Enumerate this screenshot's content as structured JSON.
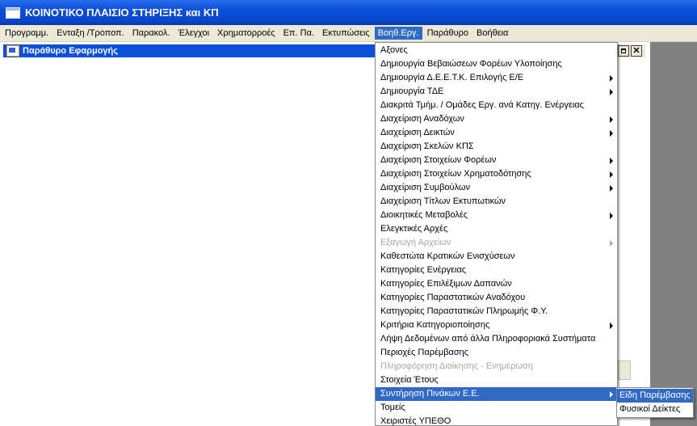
{
  "window": {
    "title": "ΚΟΙΝΟΤΙΚΟ ΠΛΑΙΣΙΟ ΣΤΗΡΙΞΗΣ και ΚΠ"
  },
  "menubar": {
    "items": [
      "Προγραμμ.",
      "Ενταξη /Τροποπ.",
      "Παρακολ.",
      "Έλεγχοι",
      "Χρηματορροές",
      "Επ. Πα.",
      "Εκτυπώσεις",
      "Βοηθ.Εργ.",
      "Παράθυρο",
      "Βοήθεια"
    ],
    "active_index": 7
  },
  "mdi_window": {
    "title": "Παράθυρο Εφαρμογής"
  },
  "menu": {
    "items": [
      {
        "label": "Αξονες",
        "submenu": false,
        "disabled": false
      },
      {
        "label": "Δημιουργία Βεβαιώσεων Φορέων Υλοποίησης",
        "submenu": false,
        "disabled": false
      },
      {
        "label": "Δημιουργία Δ.Ε.Ε.Τ.Κ. Επιλογής Ε/Ε",
        "submenu": true,
        "disabled": false
      },
      {
        "label": "Δημιουργία ΤΔΕ",
        "submenu": true,
        "disabled": false
      },
      {
        "label": "Διακριτά Τμήμ. / Ομάδες Εργ. ανά Κατηγ. Ενέργειας",
        "submenu": false,
        "disabled": false
      },
      {
        "label": "Διαχείριση Αναδόχων",
        "submenu": true,
        "disabled": false
      },
      {
        "label": "Διαχείριση Δεικτών",
        "submenu": true,
        "disabled": false
      },
      {
        "label": "Διαχείριση Σκελών ΚΠΣ",
        "submenu": false,
        "disabled": false
      },
      {
        "label": "Διαχείριση Στοιχείων Φορέων",
        "submenu": true,
        "disabled": false
      },
      {
        "label": "Διαχείριση Στοιχείων Χρηματοδότησης",
        "submenu": true,
        "disabled": false
      },
      {
        "label": "Διαχείριση Συμβούλων",
        "submenu": true,
        "disabled": false
      },
      {
        "label": "Διαχείριση Τίτλων Εκτυπωτικών",
        "submenu": false,
        "disabled": false
      },
      {
        "label": "Διοικητικές Μεταβολές",
        "submenu": true,
        "disabled": false
      },
      {
        "label": "Ελεγκτικές Αρχές",
        "submenu": false,
        "disabled": false
      },
      {
        "label": "Εξαγωγή Αρχείων",
        "submenu": true,
        "disabled": true
      },
      {
        "label": "Καθεστώτα Κρατικών Ενισχύσεων",
        "submenu": false,
        "disabled": false
      },
      {
        "label": "Κατηγορίες Ενέργειας",
        "submenu": false,
        "disabled": false
      },
      {
        "label": "Κατηγορίες Επιλέξιμων Δαπανών",
        "submenu": false,
        "disabled": false
      },
      {
        "label": "Κατηγορίες Παραστατικών Αναδόχου",
        "submenu": false,
        "disabled": false
      },
      {
        "label": "Κατηγορίες Παραστατικών Πληρωμής Φ.Υ.",
        "submenu": false,
        "disabled": false
      },
      {
        "label": "Κριτήρια Κατηγοριοποίησης",
        "submenu": true,
        "disabled": false
      },
      {
        "label": "Λήψη Δεδομένων από άλλα Πληροφοριακά Συστήματα",
        "submenu": false,
        "disabled": false
      },
      {
        "label": "Περιοχές Παρέμβασης",
        "submenu": false,
        "disabled": false
      },
      {
        "label": "Πληροφόρηση Διοίκησης - Ενημέρωση",
        "submenu": false,
        "disabled": true
      },
      {
        "label": "Στοιχεία Έτους",
        "submenu": false,
        "disabled": false
      },
      {
        "label": "Συντήρηση Πινάκων Ε.Ε.",
        "submenu": true,
        "disabled": false,
        "highlighted": true
      },
      {
        "label": "Τομείς",
        "submenu": false,
        "disabled": false
      },
      {
        "label": "Χειριστές ΥΠΕΘΟ",
        "submenu": false,
        "disabled": false
      }
    ]
  },
  "submenu": {
    "items": [
      {
        "label": "Είδη Παρέμβασης",
        "highlighted": true
      },
      {
        "label": "Φυσικοί Δείκτες",
        "highlighted": false
      }
    ]
  },
  "colors": {
    "title_bar": "#0a4fd8",
    "menu_highlight": "#316ac5",
    "menubar_bg": "#ece9d8",
    "disabled_text": "#aca899"
  }
}
